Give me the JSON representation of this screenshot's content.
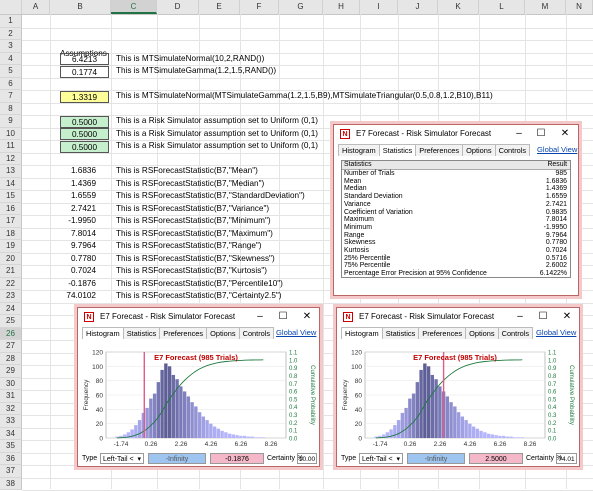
{
  "sheet": {
    "columns": [
      "A",
      "B",
      "C",
      "D",
      "E",
      "F",
      "G",
      "H",
      "I",
      "J",
      "K",
      "L",
      "M",
      "N"
    ],
    "selected_column": "C",
    "selected_row": "26",
    "rows": [
      "1",
      "2",
      "3",
      "4",
      "5",
      "6",
      "7",
      "8",
      "9",
      "10",
      "11",
      "12",
      "13",
      "14",
      "15",
      "16",
      "17",
      "18",
      "19",
      "20",
      "21",
      "22",
      "23",
      "24",
      "25",
      "26",
      "27",
      "28",
      "29",
      "30",
      "31",
      "32",
      "33",
      "34",
      "35",
      "36",
      "37",
      "38"
    ],
    "assumptions_label": "Assumptions",
    "entries": [
      {
        "value": "6.4213",
        "text": "This is MTSimulateNormal(10,2,RAND())",
        "style": "box"
      },
      {
        "value": "0.1774",
        "text": "This is MTSimulateGamma(1.2,1.5,RAND())",
        "style": "box"
      },
      {
        "value": "1.3319",
        "text": "This is MTSimulateNormal(MTSimulateGamma(1.2,1.5,B9),MTSimulateTriangular(0.5,0.8,1.2,B10),B11)",
        "style": "yellow"
      },
      {
        "value": "0.5000",
        "text": "This is a Risk Simulator assumption set to Uniform (0,1)",
        "style": "green"
      },
      {
        "value": "0.5000",
        "text": "This is a Risk Simulator assumption set to Uniform (0,1)",
        "style": "green"
      },
      {
        "value": "0.5000",
        "text": "This is a Risk Simulator assumption set to Uniform (0,1)",
        "style": "green"
      },
      {
        "value": "1.6836",
        "text": "This is RSForecastStatistic(B7,\"Mean\")",
        "style": "plain"
      },
      {
        "value": "1.4369",
        "text": "This is RSForecastStatistic(B7,\"Median\")",
        "style": "plain"
      },
      {
        "value": "1.6559",
        "text": "This is RSForecastStatistic(B7,\"StandardDeviation\")",
        "style": "plain"
      },
      {
        "value": "2.7421",
        "text": "This is RSForecastStatistic(B7,\"Variance\")",
        "style": "plain"
      },
      {
        "value": "-1.9950",
        "text": "This is RSForecastStatistic(B7,\"Minimum\")",
        "style": "plain"
      },
      {
        "value": "7.8014",
        "text": "This is RSForecastStatistic(B7,\"Maximum\")",
        "style": "plain"
      },
      {
        "value": "9.7964",
        "text": "This is RSForecastStatistic(B7,\"Range\")",
        "style": "plain"
      },
      {
        "value": "0.7780",
        "text": "This is RSForecastStatistic(B7,\"Skewness\")",
        "style": "plain"
      },
      {
        "value": "0.7024",
        "text": "This is RSForecastStatistic(B7,\"Kurtosis\")",
        "style": "plain"
      },
      {
        "value": "-0.1876",
        "text": "This is RSForecastStatistic(B7,\"Percentile10\")",
        "style": "plain"
      },
      {
        "value": "74.0102",
        "text": "This is RSForecastStatistic(B7,\"Certainty2.5\")",
        "style": "plain"
      }
    ]
  },
  "stats_window": {
    "title": "E7 Forecast - Risk Simulator Forecast",
    "tabs": [
      "Histogram",
      "Statistics",
      "Preferences",
      "Options",
      "Controls"
    ],
    "active_tab": "Statistics",
    "global_view": "Global View",
    "header": {
      "k": "Statistics",
      "v": "Result"
    },
    "rows": [
      {
        "k": "Number of Trials",
        "v": "985"
      },
      {
        "k": "Mean",
        "v": "1.6836"
      },
      {
        "k": "Median",
        "v": "1.4369"
      },
      {
        "k": "Standard Deviation",
        "v": "1.6559"
      },
      {
        "k": "Variance",
        "v": "2.7421"
      },
      {
        "k": "Coefficient of Variation",
        "v": "0.9835"
      },
      {
        "k": "Maximum",
        "v": "7.8014"
      },
      {
        "k": "Minimum",
        "v": "-1.9950"
      },
      {
        "k": "Range",
        "v": "9.7964"
      },
      {
        "k": "Skewness",
        "v": "0.7780"
      },
      {
        "k": "Kurtosis",
        "v": "0.7024"
      },
      {
        "k": "25% Percentile",
        "v": "0.5716"
      },
      {
        "k": "75% Percentile",
        "v": "2.6002"
      },
      {
        "k": "Percentage Error Precision at 95% Confidence",
        "v": "6.1422%"
      }
    ]
  },
  "hist_left": {
    "title": "E7 Forecast - Risk Simulator Forecast",
    "tabs": [
      "Histogram",
      "Statistics",
      "Preferences",
      "Options",
      "Controls"
    ],
    "global_view": "Global View",
    "chart_title": "E7 Forecast (985 Trials)",
    "type_label": "Type",
    "type_value": "Left-Tail <",
    "lower": "-Infinity",
    "upper": "-0.1876",
    "certainty_label": "Certainty %",
    "certainty": "10.00"
  },
  "hist_right": {
    "title": "E7 Forecast - Risk Simulator Forecast",
    "tabs": [
      "Histogram",
      "Statistics",
      "Preferences",
      "Options",
      "Controls"
    ],
    "global_view": "Global View",
    "chart_title": "E7 Forecast (985 Trials)",
    "type_label": "Type",
    "type_value": "Left-Tail <",
    "lower": "-Infinity",
    "upper": "2.5000",
    "certainty_label": "Certainty %",
    "certainty": "74.01"
  },
  "chart_data": [
    {
      "type": "bar",
      "title": "E7 Forecast (985 Trials)",
      "xlabel": "",
      "ylabel": "Frequency",
      "y2label": "Cumulative Probability",
      "x_ticks": [
        "-1.74",
        "0.26",
        "2.26",
        "4.26",
        "6.26",
        "8.26"
      ],
      "x_range": [
        -2.74,
        9.26
      ],
      "ylim": [
        0,
        120
      ],
      "y_ticks": [
        "0",
        "20",
        "40",
        "60",
        "80",
        "100",
        "120"
      ],
      "y2_ticks": [
        "0.0",
        "0.1",
        "0.2",
        "0.3",
        "0.4",
        "0.5",
        "0.6",
        "0.7",
        "0.8",
        "0.9",
        "1.0",
        "1.1"
      ],
      "bin_centers": [
        -2.0,
        -1.75,
        -1.5,
        -1.25,
        -1.0,
        -0.75,
        -0.5,
        -0.25,
        0.0,
        0.25,
        0.5,
        0.75,
        1.0,
        1.25,
        1.5,
        1.75,
        2.0,
        2.25,
        2.5,
        2.75,
        3.0,
        3.25,
        3.5,
        3.75,
        4.0,
        4.25,
        4.5,
        4.75,
        5.0,
        5.25,
        5.5,
        5.75,
        6.0,
        6.25,
        6.5,
        6.75,
        7.0,
        7.25,
        7.5,
        7.75
      ],
      "values": [
        2,
        3,
        5,
        8,
        12,
        18,
        25,
        35,
        42,
        55,
        62,
        78,
        95,
        104,
        100,
        88,
        82,
        72,
        65,
        58,
        50,
        44,
        36,
        30,
        25,
        20,
        16,
        13,
        10,
        8,
        6,
        5,
        4,
        3,
        3,
        2,
        2,
        1,
        1,
        1
      ],
      "threshold": -0.1876
    },
    {
      "type": "bar",
      "title": "E7 Forecast (985 Trials)",
      "xlabel": "",
      "ylabel": "Frequency",
      "y2label": "Cumulative Probability",
      "x_ticks": [
        "-1.74",
        "0.26",
        "2.26",
        "4.26",
        "6.26",
        "8.26"
      ],
      "x_range": [
        -2.74,
        9.26
      ],
      "ylim": [
        0,
        120
      ],
      "y_ticks": [
        "0",
        "20",
        "40",
        "60",
        "80",
        "100",
        "120"
      ],
      "y2_ticks": [
        "0.0",
        "0.1",
        "0.2",
        "0.3",
        "0.4",
        "0.5",
        "0.6",
        "0.7",
        "0.8",
        "0.9",
        "1.0",
        "1.1"
      ],
      "bin_centers": [
        -2.0,
        -1.75,
        -1.5,
        -1.25,
        -1.0,
        -0.75,
        -0.5,
        -0.25,
        0.0,
        0.25,
        0.5,
        0.75,
        1.0,
        1.25,
        1.5,
        1.75,
        2.0,
        2.25,
        2.5,
        2.75,
        3.0,
        3.25,
        3.5,
        3.75,
        4.0,
        4.25,
        4.5,
        4.75,
        5.0,
        5.25,
        5.5,
        5.75,
        6.0,
        6.25,
        6.5,
        6.75,
        7.0,
        7.25,
        7.5,
        7.75
      ],
      "values": [
        2,
        3,
        5,
        8,
        12,
        18,
        25,
        35,
        42,
        55,
        62,
        78,
        95,
        104,
        100,
        88,
        82,
        72,
        65,
        58,
        50,
        44,
        36,
        30,
        25,
        20,
        16,
        13,
        10,
        8,
        6,
        5,
        4,
        3,
        3,
        2,
        2,
        1,
        1,
        1
      ],
      "threshold": 2.5
    }
  ],
  "colors": {
    "yellow": "#ffff99",
    "green": "#c6efce",
    "bar_dark": "#5c5c9e",
    "bar_light": "#d8d8ef",
    "cum_line": "#1e7a3e",
    "threshold": "#e05a8a",
    "lower_fill": "#9ec5f0",
    "upper_fill": "#f4b8c8"
  }
}
